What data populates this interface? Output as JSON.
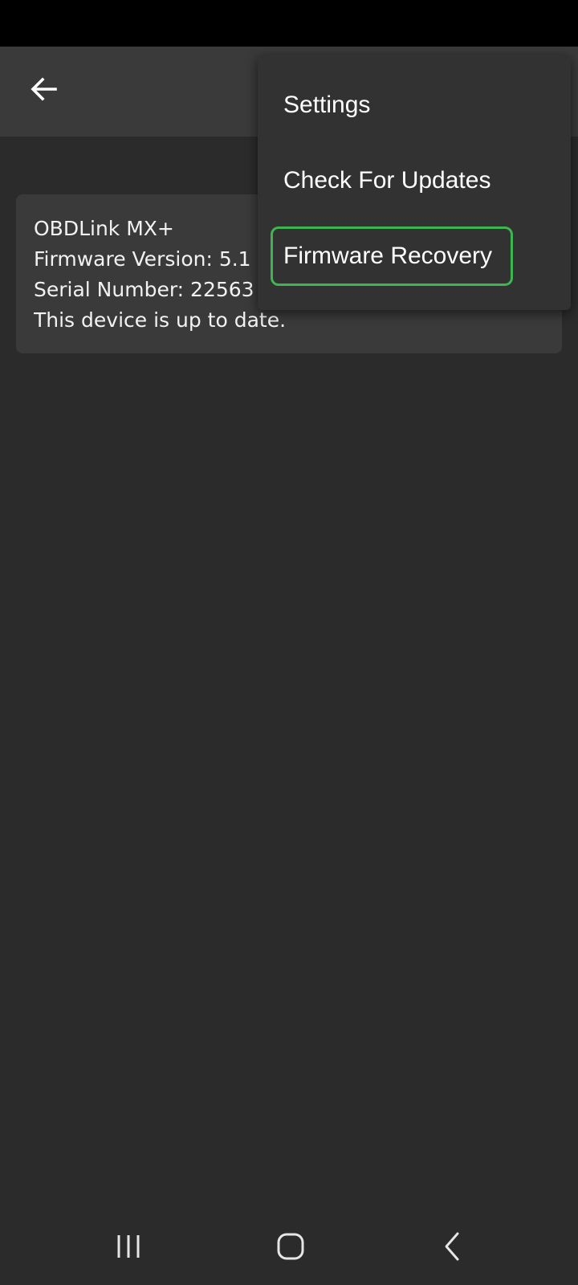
{
  "colors": {
    "background": "#2b2b2b",
    "app_bar": "#3a3a3a",
    "card": "#3a3a3a",
    "menu": "#323232",
    "highlight_border": "#3fb551",
    "text": "#ffffff"
  },
  "app_bar": {
    "back_icon": "arrow-left-icon"
  },
  "device": {
    "name": "OBDLink MX+",
    "firmware": "Firmware Version: 5.1",
    "serial": "Serial Number: 22563",
    "status": "This device is up to date."
  },
  "menu": {
    "items": [
      {
        "label": "Settings"
      },
      {
        "label": "Check For Updates"
      },
      {
        "label": "Firmware Recovery",
        "highlighted": true
      }
    ]
  },
  "nav": {
    "recents_icon": "recents-icon",
    "home_icon": "home-icon",
    "back_icon": "chevron-left-icon"
  }
}
